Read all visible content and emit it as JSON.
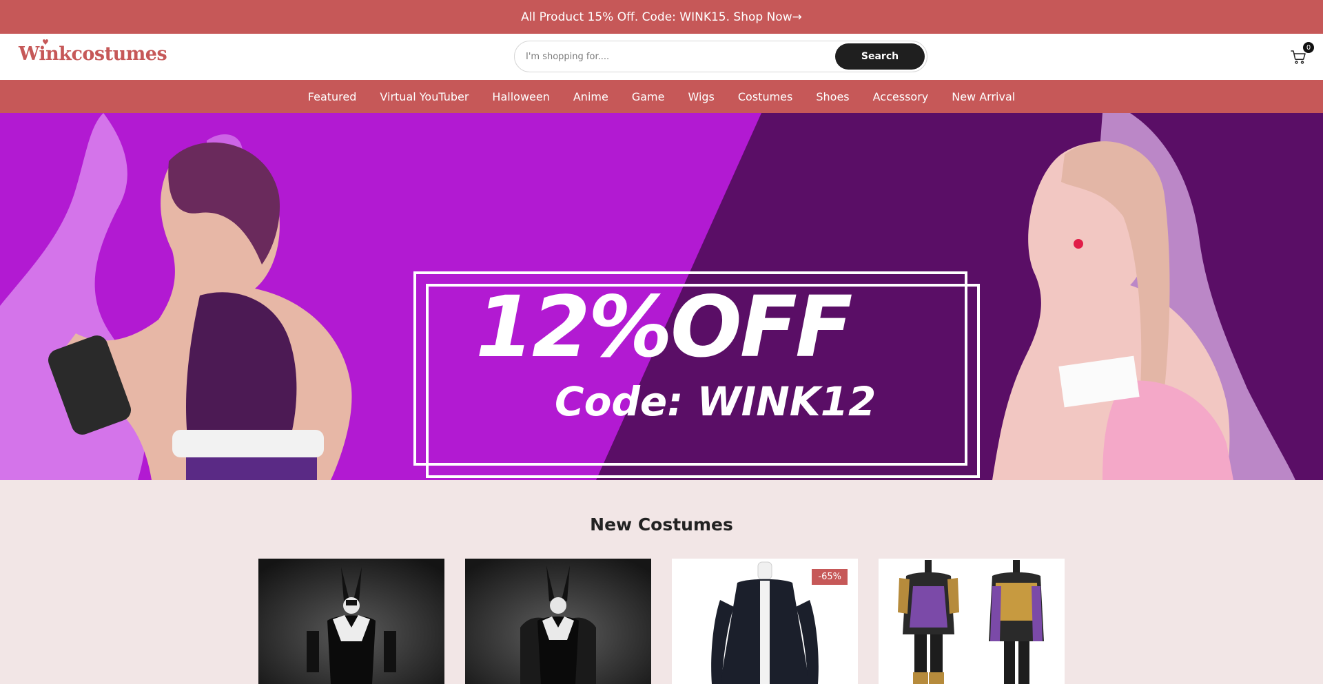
{
  "announcement": {
    "text": "All Product 15% Off. Code: WINK15. Shop Now→"
  },
  "header": {
    "logo_text": "Winkcostumes",
    "search": {
      "placeholder": "I'm shopping for....",
      "value": "",
      "button_label": "Search"
    },
    "cart_count": "0"
  },
  "nav": {
    "items": [
      {
        "label": "Featured"
      },
      {
        "label": "Virtual YouTuber"
      },
      {
        "label": "Halloween"
      },
      {
        "label": "Anime"
      },
      {
        "label": "Game"
      },
      {
        "label": "Wigs"
      },
      {
        "label": "Costumes"
      },
      {
        "label": "Shoes"
      },
      {
        "label": "Accessory"
      },
      {
        "label": "New Arrival"
      }
    ]
  },
  "hero": {
    "title": "12%OFF",
    "code": "Code: WINK12"
  },
  "section": {
    "title": "New Costumes"
  },
  "products": [
    {
      "badge": ""
    },
    {
      "badge": ""
    },
    {
      "badge": "-65%"
    },
    {
      "badge": ""
    }
  ],
  "colors": {
    "brand": "#c65858",
    "hero_left": "#b21ad2",
    "hero_right": "#5a0e66",
    "button_dark": "#1f1f1f"
  },
  "icons": {
    "cart": "shopping-cart-icon",
    "logo_heart": "heart-icon"
  }
}
